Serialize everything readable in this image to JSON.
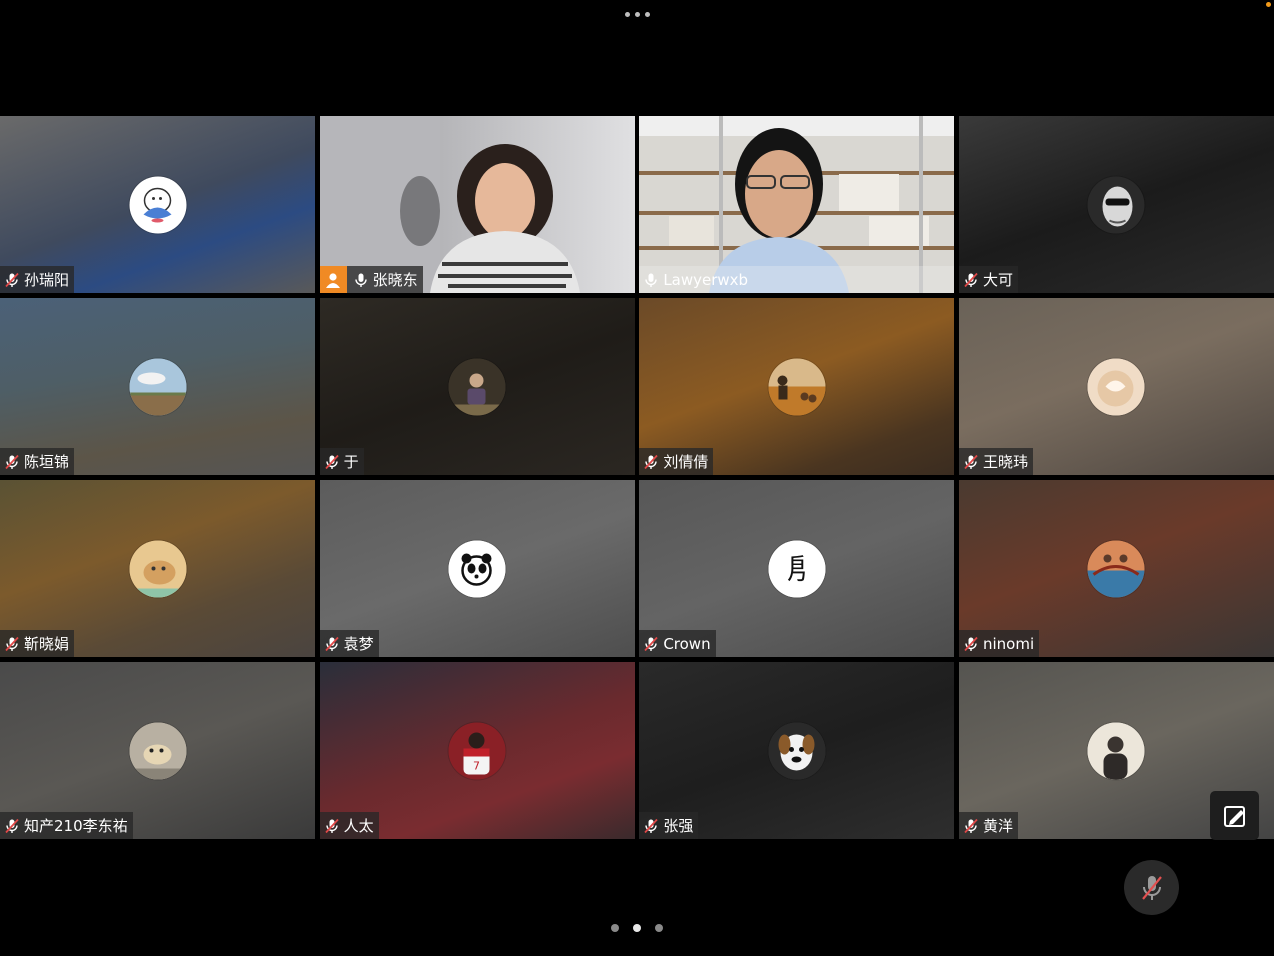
{
  "participants": [
    {
      "name": "孙瑞阳",
      "muted": true,
      "avatar": "whale-icon",
      "bg": "linear-gradient(160deg,#6a6a6a,#3f4a5e 50%,#2c4b82 70%,#595959)",
      "avatarBg": "#ffffff"
    },
    {
      "name": "张晓东",
      "muted": false,
      "video": true,
      "presenter": true
    },
    {
      "name": "Lawyerwxb",
      "muted": false,
      "video": true,
      "active": true
    },
    {
      "name": "大可",
      "muted": true,
      "avatar": "face-icon",
      "bg": "linear-gradient(160deg,#3a3a3a,#1b1b1b 50%,#2b2b2b)",
      "avatarBg": "#222222"
    },
    {
      "name": "陈垣锦",
      "muted": true,
      "avatar": "sky-icon",
      "bg": "linear-gradient(170deg,#4b6178,#4e5e66 40%,#5c5548 75%,#555)",
      "avatarBg": "#9db8cc"
    },
    {
      "name": "于",
      "muted": true,
      "avatar": "child-icon",
      "bg": "linear-gradient(160deg,#2e2a24,#1f1c18 50%,#2b2722)",
      "avatarBg": "#3d3a2e"
    },
    {
      "name": "刘倩倩",
      "muted": true,
      "avatar": "beach-icon",
      "bg": "linear-gradient(160deg,#6b4a28,#8c5b22 45%,#4a3520 80%,#3a2c20)",
      "avatarBg": "#c98a3b"
    },
    {
      "name": "王晓玮",
      "muted": true,
      "avatar": "latte-icon",
      "bg": "linear-gradient(160deg,#6a6258,#7a6d5f 45%,#4e4640)",
      "avatarBg": "#e8d4c0"
    },
    {
      "name": "靳晓娟",
      "muted": true,
      "avatar": "cat-icon",
      "bg": "linear-gradient(160deg,#5a5234,#7c5a2c 40%,#5a4a36 70%,#4a4440)",
      "avatarBg": "#d8a96a"
    },
    {
      "name": "袁梦",
      "muted": true,
      "avatar": "panda-icon",
      "bg": "linear-gradient(160deg,#5c5c5c,#6a6a6a 50%,#4e4e4e)",
      "avatarBg": "#ffffff"
    },
    {
      "name": "Crown",
      "muted": true,
      "avatar": "calligraphy-icon",
      "bg": "linear-gradient(160deg,#575757,#646464 50%,#4c4c4c)",
      "avatarBg": "#ffffff"
    },
    {
      "name": "ninomi",
      "muted": true,
      "avatar": "bridge-icon",
      "bg": "linear-gradient(160deg,#4a3a30,#6a3a2a 45%,#3a3634)",
      "avatarBg": "#c47a52"
    },
    {
      "name": "知产210李东祐",
      "muted": true,
      "avatar": "dog-icon",
      "bg": "linear-gradient(160deg,#4a4a4a,#5a5854 50%,#3a3a3a)",
      "avatarBg": "#bfb6a8"
    },
    {
      "name": "人太",
      "muted": true,
      "avatar": "footballer-icon",
      "bg": "linear-gradient(160deg,#2a2e3a,#6a2a2e 50%,#7a2c30 70%,#3a2a2c)",
      "avatarBg": "#7a1f24"
    },
    {
      "name": "张强",
      "muted": true,
      "avatar": "boxer-dog-icon",
      "bg": "linear-gradient(160deg,#2a2a2a,#1e1e1e 50%,#2e2e2e)",
      "avatarBg": "#3a3a3a"
    },
    {
      "name": "黄洋",
      "muted": true,
      "avatar": "person-icon",
      "bg": "linear-gradient(160deg,#555450,#6a665e 50%,#444)",
      "avatarBg": "#e8e2d6"
    }
  ],
  "controls": {
    "edit": "edit-icon",
    "mic": "mic-off-icon"
  },
  "pagination": {
    "pages": 3,
    "current": 2
  }
}
